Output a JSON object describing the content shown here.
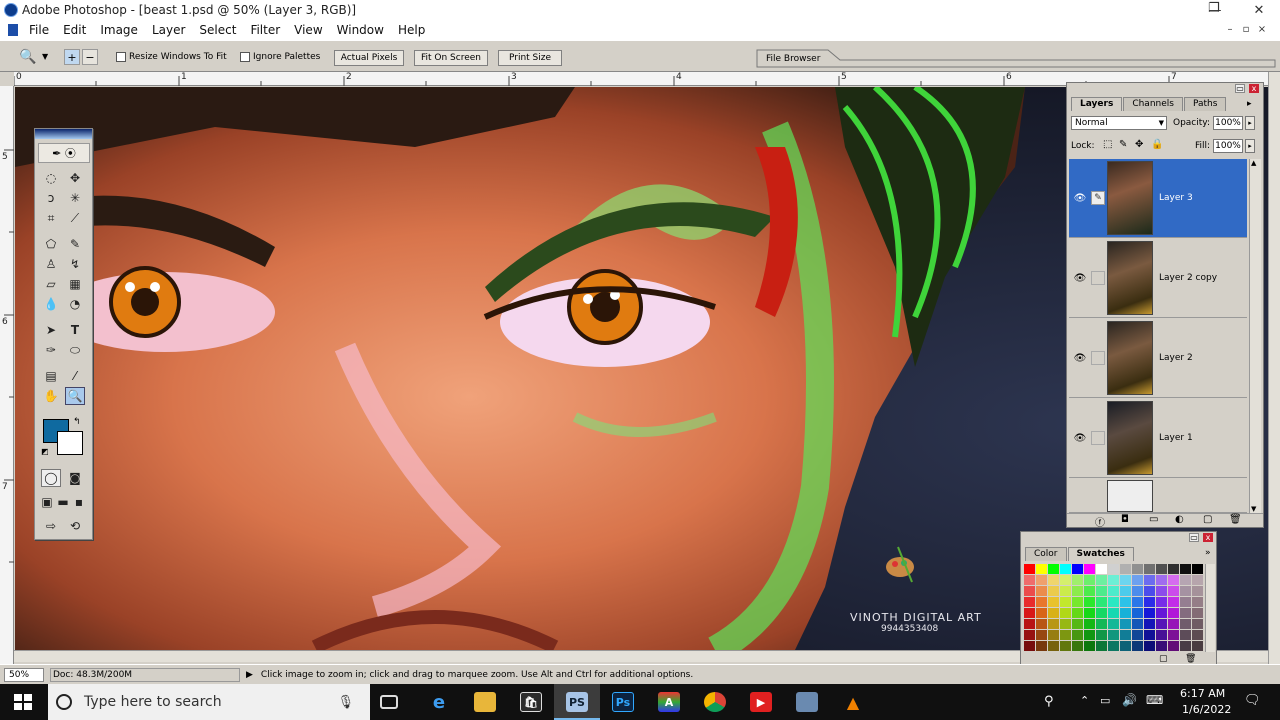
{
  "window": {
    "title": "Adobe Photoshop - [beast 1.psd @ 50% (Layer 3, RGB)]",
    "minimize": "—",
    "maximize": "❐",
    "close": "✕"
  },
  "menu": [
    "File",
    "Edit",
    "Image",
    "Layer",
    "Select",
    "Filter",
    "View",
    "Window",
    "Help"
  ],
  "options": {
    "resize_windows": "Resize Windows To Fit",
    "ignore_palettes": "Ignore Palettes",
    "actual_pixels": "Actual Pixels",
    "fit_on_screen": "Fit On Screen",
    "print_size": "Print Size",
    "file_browser": "File Browser"
  },
  "ruler": {
    "top": [
      "0",
      "1",
      "2",
      "3",
      "4",
      "5",
      "6",
      "7"
    ],
    "left": [
      "5",
      "6",
      "7"
    ]
  },
  "canvas": {
    "watermark_name": "VINOTH DIGITAL ART",
    "watermark_phone": "9944353408"
  },
  "layers_panel": {
    "tabs": [
      "Layers",
      "Channels",
      "Paths"
    ],
    "blend_mode": "Normal",
    "opacity_label": "Opacity:",
    "opacity_value": "100%",
    "lock_label": "Lock:",
    "fill_label": "Fill:",
    "fill_value": "100%",
    "layers": [
      {
        "name": "Layer 3",
        "selected": true
      },
      {
        "name": "Layer 2 copy",
        "selected": false
      },
      {
        "name": "Layer 2",
        "selected": false
      },
      {
        "name": "Layer 1",
        "selected": false
      }
    ]
  },
  "swatches_panel": {
    "tabs": [
      "Color",
      "Swatches"
    ]
  },
  "status": {
    "zoom": "50%",
    "doc": "Doc: 48.3M/200M",
    "hint": "Click image to zoom in; click and drag to marquee zoom.  Use Alt and Ctrl for additional options."
  },
  "taskbar": {
    "search_placeholder": "Type here to search",
    "time": "6:17 AM",
    "date": "1/6/2022"
  },
  "colors": {
    "accent": "#316ac5",
    "foreground": "#0f6aa0",
    "background": "#ffffff"
  }
}
